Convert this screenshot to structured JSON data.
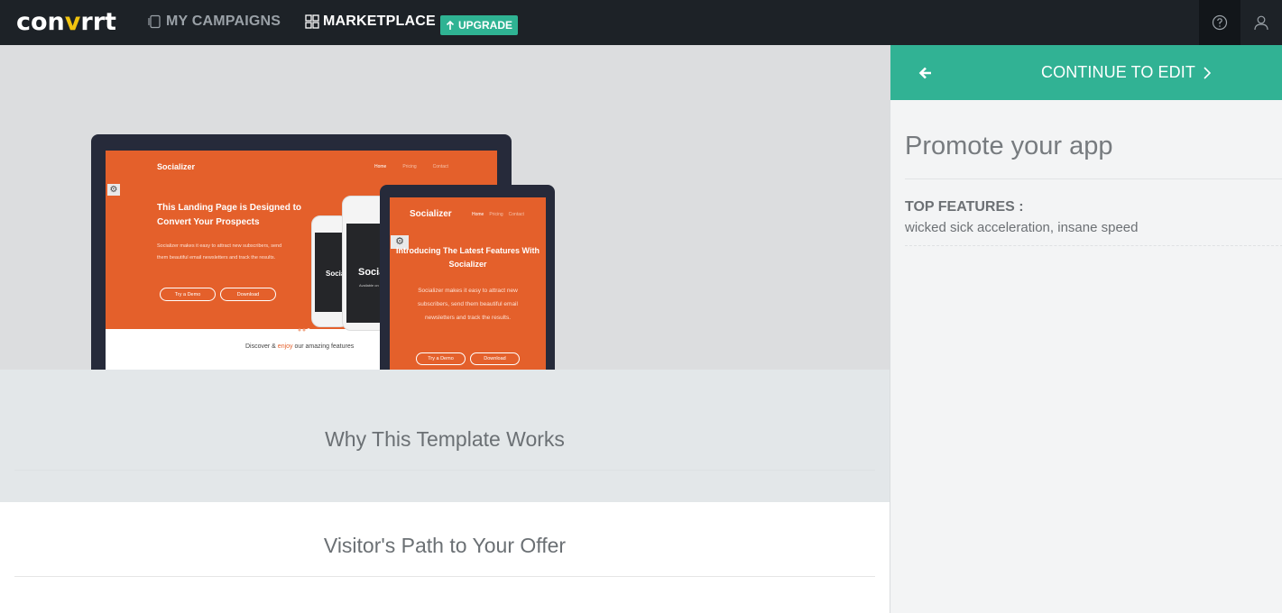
{
  "header": {
    "logo_text_a": "con",
    "logo_text_v": "v",
    "logo_text_b": "rrt",
    "nav_campaigns": "MY CAMPAIGNS",
    "nav_marketplace": "MARKETPLACE",
    "upgrade": "UPGRADE"
  },
  "preview": {
    "laptop": {
      "brand": "Socializer",
      "menu": [
        "Home",
        "Pricing",
        "Contact"
      ],
      "headline": "This Landing Page is Designed to Convert Your Prospects",
      "body": "Socializer makes it easy to attract new subscribers, send them beautiful email newsletters and track the results.",
      "btn_demo": "Try a Demo",
      "btn_download": "Download",
      "footer_pre": "Discover & ",
      "footer_accent": "enjoy",
      "footer_post": " our amazing features",
      "phone_text": "Socializer",
      "phone_sub": "Available on"
    },
    "tablet": {
      "brand": "Socializer",
      "menu": [
        "Home",
        "Pricing",
        "Contact"
      ],
      "headline": "Introducing The Latest Features With Socializer",
      "body": "Socializer makes it easy to attract new subscribers, send them beautiful email newsletters and track the results.",
      "btn_demo": "Try a Demo",
      "btn_download": "Download"
    }
  },
  "sections": {
    "why": "Why This Template Works",
    "visitor": "Visitor's Path to Your Offer"
  },
  "panel": {
    "continue": "CONTINUE TO EDIT",
    "title": "Promote your app",
    "features_label": "TOP FEATURES :",
    "features_text": "wicked sick acceleration, insane speed"
  },
  "colors": {
    "topbar": "#1d2227",
    "accent": "#31b294",
    "preview_orange": "#e4602b"
  }
}
